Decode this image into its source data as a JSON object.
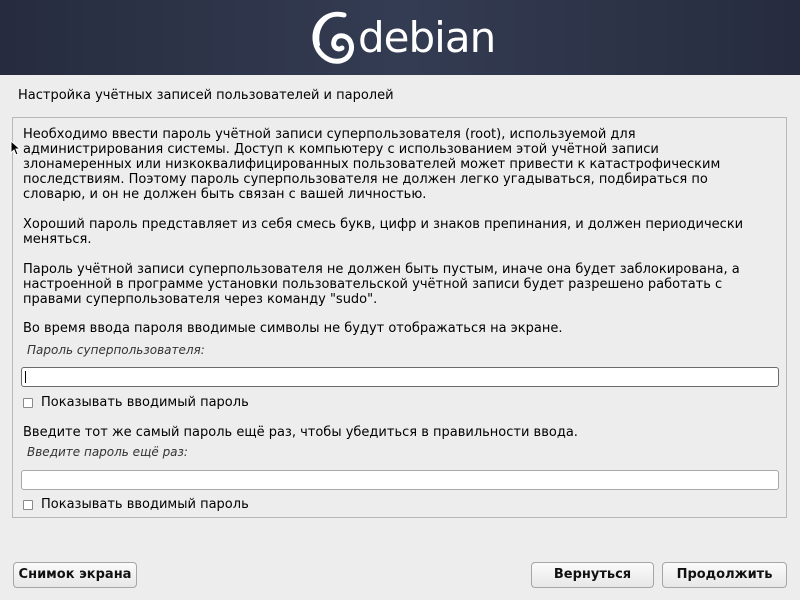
{
  "banner": {
    "logo_text": "debian"
  },
  "step_title": "Настройка учётных записей пользователей и паролей",
  "panel": {
    "paragraphs": [
      "Необходимо ввести пароль учётной записи суперпользователя (root), используемой для\nадминистрирования системы. Доступ к компьютеру с использованием этой учётной записи\nзлонамеренных или низкоквалифицированных пользователей может привести к катастрофическим\nпоследствиям. Поэтому пароль суперпользователя не должен легко угадываться, подбираться по\nсловарю, и он не должен быть связан с вашей личностью.",
      "Хороший пароль представляет из себя смесь букв, цифр и знаков препинания, и должен периодически\nменяться.",
      "Пароль учётной записи суперпользователя не должен быть пустым, иначе она будет заблокирована, а\nнастроенной в программе установки пользовательской учётной записи будет разрешено работать с\nправами суперпользователя через команду \"sudo\".",
      "Во время ввода пароля вводимые символы не будут отображаться на экране."
    ],
    "root_password": {
      "label": "Пароль суперпользователя:",
      "value": "",
      "show_password_label": "Показывать вводимый пароль",
      "show_password_checked": false
    },
    "confirm_prompt": "Введите тот же самый пароль ещё раз, чтобы убедиться в правильности ввода.",
    "confirm_password": {
      "label": "Введите пароль ещё раз:",
      "value": "",
      "show_password_label": "Показывать вводимый пароль",
      "show_password_checked": false
    }
  },
  "buttons": {
    "screenshot": "Снимок экрана",
    "back": "Вернуться",
    "continue": "Продолжить"
  },
  "colors": {
    "banner_bg": "#2c3346",
    "logo_swirl": "#c70036",
    "page_bg": "#ededed"
  }
}
